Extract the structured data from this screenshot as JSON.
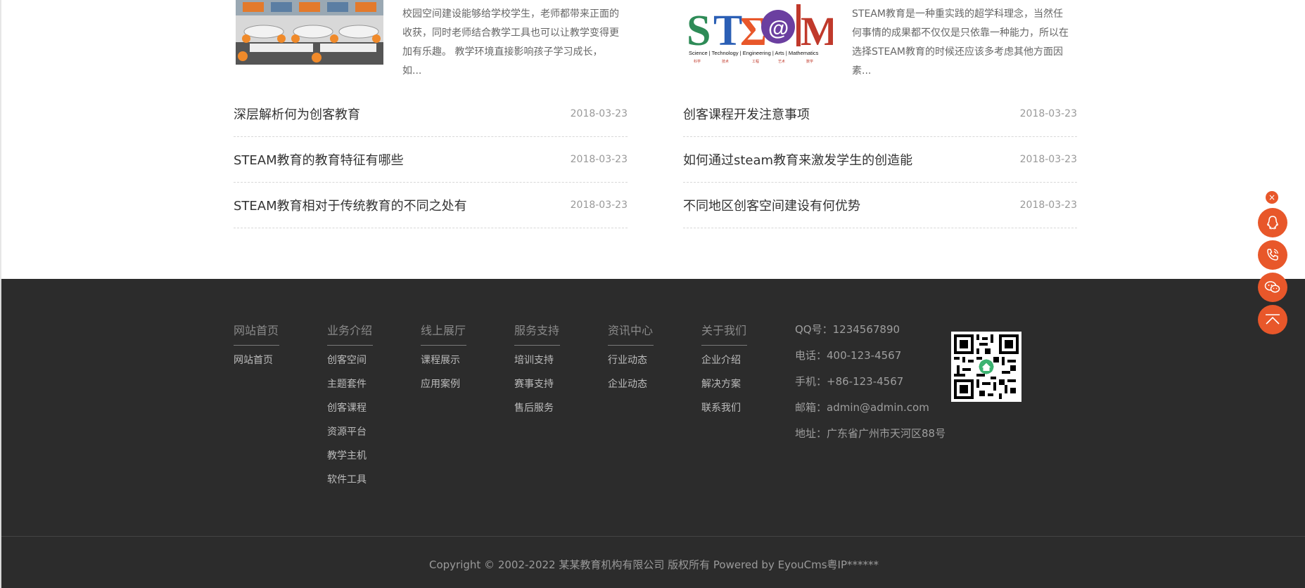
{
  "articles": [
    {
      "summary": "校园空间建设能够给学校学生，老师都带来正面的收获，同时老师结合教学工具也可以让教学变得更加有乐趣。 教学环境直接影响孩子学习成长，如..."
    },
    {
      "summary": "STEAM教育是一种重实践的超学科理念，当然任何事情的成果都不仅仅是只依靠一种能力，所以在选择STEAM教育的时候还应该多考虑其他方面因素..."
    }
  ],
  "steam_logo": {
    "letters": [
      "S",
      "T",
      "Σ",
      "@",
      "M"
    ],
    "caption": "Science | Technology | Engineering | Arts | Mathematics",
    "sub_labels": [
      "科学",
      "技术",
      "工程",
      "艺术",
      "数学"
    ]
  },
  "news_left": [
    {
      "title": "深层解析何为创客教育",
      "date": "2018-03-23"
    },
    {
      "title": "STEAM教育的教育特征有哪些",
      "date": "2018-03-23"
    },
    {
      "title": "STEAM教育相对于传统教育的不同之处有",
      "date": "2018-03-23"
    }
  ],
  "news_right": [
    {
      "title": "创客课程开发注意事项",
      "date": "2018-03-23"
    },
    {
      "title": "如何通过steam教育来激发学生的创造能",
      "date": "2018-03-23"
    },
    {
      "title": "不同地区创客空间建设有何优势",
      "date": "2018-03-23"
    }
  ],
  "footer_nav": [
    {
      "head": "网站首页",
      "links": [
        "网站首页"
      ]
    },
    {
      "head": "业务介绍",
      "links": [
        "创客空间",
        "主题套件",
        "创客课程",
        "资源平台",
        "教学主机",
        "软件工具"
      ]
    },
    {
      "head": "线上展厅",
      "links": [
        "课程展示",
        "应用案例"
      ]
    },
    {
      "head": "服务支持",
      "links": [
        "培训支持",
        "赛事支持",
        "售后服务"
      ]
    },
    {
      "head": "资讯中心",
      "links": [
        "行业动态",
        "企业动态"
      ]
    },
    {
      "head": "关于我们",
      "links": [
        "企业介绍",
        "解决方案",
        "联系我们"
      ]
    }
  ],
  "contact": {
    "qq": "QQ号：1234567890",
    "phone": "电话：400-123-4567",
    "mobile": "手机：+86-123-4567",
    "email": "邮箱：admin@admin.com",
    "address": "地址：广东省广州市天河区88号"
  },
  "copyright": "Copyright © 2002-2022 某某教育机构有限公司 版权所有 Powered by EyouCms粤IP******",
  "float_bar": {
    "close": "×",
    "icons": [
      "qq-icon",
      "phone-icon",
      "wechat-icon",
      "back-to-top-icon"
    ]
  },
  "colors": {
    "accent": "#e8572a",
    "footer_bg": "#2c2c2c"
  }
}
